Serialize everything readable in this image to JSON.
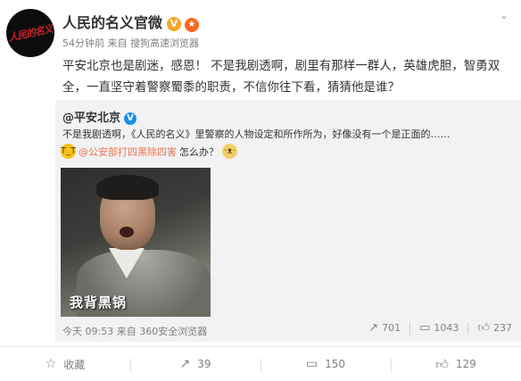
{
  "post": {
    "avatar_text": "人民的名义",
    "username": "人民的名义官微",
    "time": "54分钟前",
    "source_prefix": "来自",
    "source": "搜狗高速浏览器",
    "text": "平安北京也是剧迷，感恩！ 不是我剧透啊，剧里有那样一群人，英雄虎胆，智勇双全，一直坚守着警察蜀黍的职责，不信你往下看，猜猜他是谁？"
  },
  "repost": {
    "author": "@平安北京",
    "text1": "不是我剧透啊，《人民的名义》里警察的人物设定和所作所为，好像没有一个是正面的……",
    "mention": "@公安部打四黑除四害",
    "text2_suffix": "怎么办？",
    "image_caption": "我背黑锅",
    "time": "今天 09:53",
    "source_prefix": "来自",
    "source": "360安全浏览器",
    "actions": {
      "forward": "701",
      "comment": "1043",
      "like": "237"
    }
  },
  "footer": {
    "favorite": "收藏",
    "forward": "39",
    "comment": "150",
    "like": "129"
  },
  "colors": {
    "mention": "#eb7350",
    "verified_gold": "#f6a623",
    "verified_blue": "#1f90e6"
  },
  "icons": [
    "chevron-down-icon",
    "verified-gold-icon",
    "medal-icon",
    "verified-blue-icon",
    "crying-emoji-icon",
    "doge-emoji-icon",
    "forward-icon",
    "comment-icon",
    "like-icon",
    "favorite-icon"
  ]
}
